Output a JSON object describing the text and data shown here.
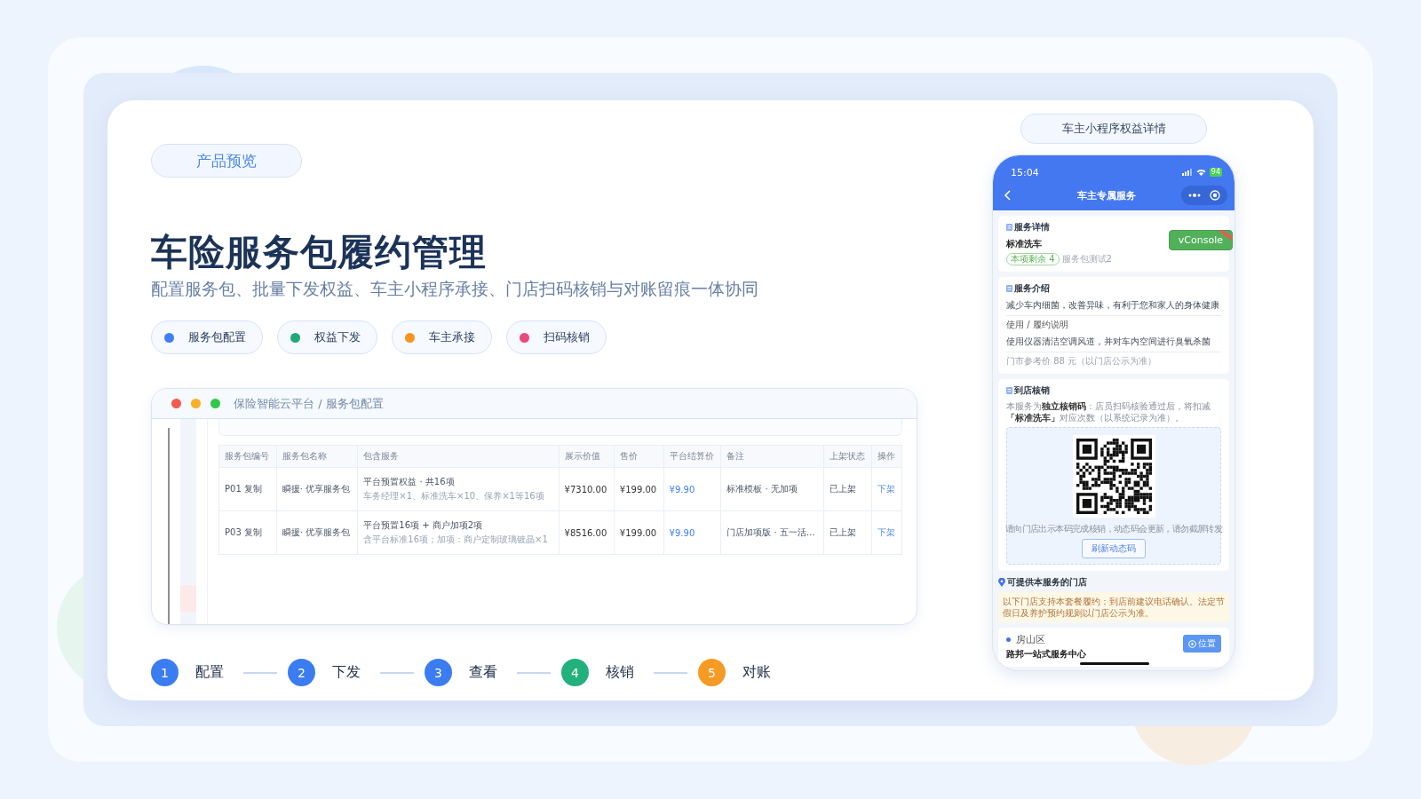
{
  "badge": "产品预览",
  "title": "车险服务包履约管理",
  "subtitle": "配置服务包、批量下发权益、车主小程序承接、门店扫码核销与对账留痕一体协同",
  "tags": [
    {
      "label": "服务包配置",
      "color": "#3f7ef5"
    },
    {
      "label": "权益下发",
      "color": "#22a876"
    },
    {
      "label": "车主承接",
      "color": "#f7931e"
    },
    {
      "label": "扫码核销",
      "color": "#e84a7a"
    }
  ],
  "browser_window": {
    "breadcrumb": "保险智能云平台 / 服务包配置",
    "table": {
      "columns": [
        {
          "label": "服务包编号",
          "kind": "text"
        },
        {
          "label": "服务包名称",
          "kind": "text"
        },
        {
          "label": "包含服务",
          "kind": "multiline"
        },
        {
          "label": "展示价值",
          "kind": "amount"
        },
        {
          "label": "售价",
          "kind": "amount"
        },
        {
          "label": "平台结算价",
          "kind": "price"
        },
        {
          "label": "备注",
          "kind": "text"
        },
        {
          "label": "上架状态",
          "kind": "text"
        },
        {
          "label": "操作",
          "kind": "link"
        }
      ],
      "rows": [
        [
          "P01  复制",
          "瞬援·  优享服务包",
          [
            "平台预置权益 ·   共16项",
            "车务经理×1、标准洗车×10、保养×1等16项"
          ],
          "¥7310.00",
          "¥199.00",
          "¥9.90",
          "标准模板 ·   无加项",
          "已上架",
          "下架"
        ],
        [
          "P03  复制",
          "瞬援·  优享服务包",
          [
            "平台预置16项 + 商户加项2项",
            "含平台标准16项；加项：商户定制玻璃镀晶×1"
          ],
          "¥8516.00",
          "¥199.00",
          "¥9.90",
          "门店加项版 ·   五一活…",
          "已上架",
          "下架"
        ]
      ]
    }
  },
  "steps": [
    {
      "number": "1",
      "label": "配置",
      "color": "#3b7cf0"
    },
    {
      "number": "2",
      "label": "下发",
      "color": "#3b7cf0"
    },
    {
      "number": "3",
      "label": "查看",
      "color": "#3b7cf0"
    },
    {
      "number": "4",
      "label": "核销",
      "color": "#22b07d"
    },
    {
      "number": "5",
      "label": "对账",
      "color": "#f59a23"
    }
  ],
  "phone_caption": "车主小程序权益详情",
  "phone": {
    "time": "15:04",
    "battery": "94",
    "nav_title": "车主专属服务",
    "vconsole": "vConsole",
    "detail_card": {
      "heading": "服务详情",
      "name": "标准洗车",
      "remaining": "本项剩余 4",
      "package": "服务包测试2"
    },
    "intro_card": {
      "heading": "服务介绍",
      "text": "减少车内细菌，改善异味，有利于您和家人的身体健康",
      "usage_label": "使用 / 履约说明",
      "usage_text": "使用仪器清洁空调风道，并对车内空间进行臭氧杀菌",
      "price_note": "门市参考价 88 元（以门店公示为准）"
    },
    "redeem_card": {
      "heading": "到店核销",
      "description": "本服务为**独立核销码**：店员扫码核验通过后，将扣减**「标准洗车」**对应次数（以系统记录为准）。",
      "qr_hint": "请向门店出示本码完成核销，动态码会更新，请勿截屏转发",
      "refresh_button": "刷新动态码"
    },
    "stores": {
      "heading": "可提供本服务的门店",
      "notice": "以下门店支持本套餐履约：到店前建议电话确认。法定节假日及养护预约规则以门店公示为准。",
      "district": "房山区",
      "store_name": "路邦一站式服务中心",
      "location_button": "位置"
    }
  }
}
